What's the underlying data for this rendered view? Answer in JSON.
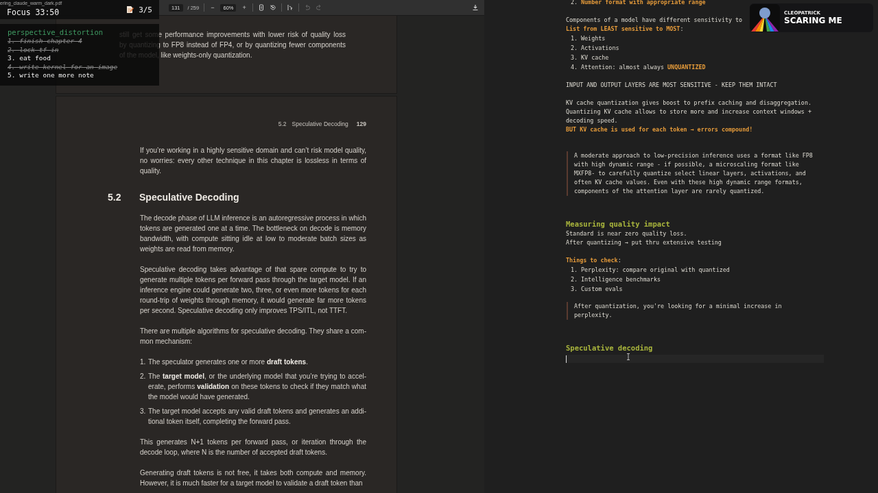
{
  "pdf_viewer": {
    "file_name": "ering_claude_warm_dark.pdf",
    "toolbar": {
      "page": "131",
      "page_total": "/ 259",
      "zoom_out": "−",
      "zoom": "60%",
      "zoom_in": "+",
      "history_disabled": true
    },
    "previous_page": {
      "lines": [
        "still get some performance improvements with lower risk of quality loss",
        "by quantizing to FP8 instead of FP4, or by quantizing fewer components",
        "of the model, like weights-only quantization."
      ]
    },
    "page": {
      "running_head": {
        "section": "5.2",
        "title": "Speculative Decoding",
        "page_number": "129"
      },
      "blocks": [
        {
          "kind": "paragraph",
          "lines": [
            "If you’re working in a highly sensitive domain and can’t risk model quality,",
            "no worries: every other technique in this chapter is lossless in terms of",
            "quality."
          ]
        },
        {
          "kind": "heading",
          "number": "5.2",
          "title": "Speculative Decoding"
        },
        {
          "kind": "paragraph",
          "lines": [
            "The decode phase of LLM inference is an autoregressive process in which",
            "tokens are generated one at a time. The bottleneck on decode is memory",
            "bandwidth, with compute sitting idle at low to moderate batch sizes as",
            "weights are read from memory."
          ]
        },
        {
          "kind": "paragraph",
          "lines": [
            "Speculative decoding takes advantage of that spare compute to try to",
            "generate multiple tokens per forward pass through the target model. If an",
            "inference engine could generate two, three, or even more tokens for each",
            "round-trip of weights through memory, it would generate far more tokens",
            "per second. Speculative decoding only improves TPS/ITL, not TTFT."
          ]
        },
        {
          "kind": "paragraph",
          "lines": [
            "There are multiple algorithms for speculative decoding. They share a com-",
            "mon mechanism:"
          ]
        },
        {
          "kind": "list",
          "items": [
            {
              "number": "1.",
              "lines": [
                "The speculator generates one or more **draft tokens**."
              ]
            },
            {
              "number": "2.",
              "lines": [
                "The **target model**, or the underlying model that you’re trying to accel-",
                "erate, performs **validation** on these tokens to check if they match what",
                "the model would have generated."
              ]
            },
            {
              "number": "3.",
              "lines": [
                "The target model accepts any valid draft tokens and generates an addi-",
                "tional token itself, completing the forward pass."
              ]
            }
          ]
        },
        {
          "kind": "paragraph",
          "lines": [
            "This generates N+1 tokens per forward pass, or iteration through the",
            "decode loop, where N is the number of accepted draft tokens."
          ]
        },
        {
          "kind": "paragraph",
          "lines": [
            "Generating draft tokens is not free, it takes both compute and memory.",
            "However, it is much faster for a target model to validate a draft token than"
          ]
        }
      ]
    }
  },
  "focus_timer": {
    "label": "Focus 33:50",
    "count": "3/5"
  },
  "todo": {
    "title": "perspective_distortion",
    "items": [
      {
        "text": "1. finish chapter 4",
        "done": true
      },
      {
        "text": "2. lock tf in",
        "done": true
      },
      {
        "text": "3. eat food",
        "done": false
      },
      {
        "text": "4. write kernel for an image",
        "done": true
      },
      {
        "text": "5. write one more note",
        "done": false
      }
    ]
  },
  "notes": {
    "blocks": [
      {
        "kind": "list",
        "items": [
          {
            "number": "2.",
            "parts": [
              {
                "text": "Number format with appropriate range",
                "kind": "accent"
              }
            ]
          }
        ]
      },
      {
        "kind": "text",
        "lines": [
          [
            {
              "text": "Components of a model have different sensitivity to",
              "kind": "plain"
            }
          ],
          [
            {
              "text": "List from LEAST sensitive to MOST",
              "kind": "accent"
            },
            {
              "text": ":",
              "kind": "plain"
            }
          ]
        ]
      },
      {
        "kind": "list",
        "items": [
          {
            "number": "1.",
            "parts": [
              {
                "text": "Weights",
                "kind": "plain"
              }
            ]
          },
          {
            "number": "2.",
            "parts": [
              {
                "text": "Activations",
                "kind": "plain"
              }
            ]
          },
          {
            "number": "3.",
            "parts": [
              {
                "text": "KV cache",
                "kind": "plain"
              }
            ]
          },
          {
            "number": "4.",
            "parts": [
              {
                "text": "Attention: almost always ",
                "kind": "plain"
              },
              {
                "text": "UNQUANTIZED",
                "kind": "accent"
              }
            ]
          }
        ]
      },
      {
        "kind": "text",
        "lines": [
          [
            {
              "text": "INPUT AND OUTPUT LAYERS ARE MOST SENSITIVE - KEEP THEM INTACT",
              "kind": "plain"
            }
          ]
        ]
      },
      {
        "kind": "text",
        "lines": [
          [
            {
              "text": "KV cache quantization gives boost to prefix caching and disaggregation.",
              "kind": "plain"
            }
          ],
          [
            {
              "text": "Quantizing KV cache allows to store more and increase context windows +",
              "kind": "plain"
            }
          ],
          [
            {
              "text": "decoding speed.",
              "kind": "plain"
            }
          ],
          [
            {
              "text": "BUT KV cache is used for each token → errors compound!",
              "kind": "accent"
            }
          ]
        ]
      },
      {
        "kind": "quote",
        "lines": [
          "A moderate approach to low-precision inference uses a format like FP8",
          "with high dynamic range - if possible, a microscaling format like",
          "MXFP8- to carefully quantize select linear layers, activations, and",
          "often KV cache values. Even with these high dynamic range formats,",
          "components of the attention layer are rarely quantized."
        ]
      },
      {
        "kind": "section",
        "lines": [
          [
            {
              "text": "Measuring quality impact",
              "kind": "heading"
            }
          ],
          [
            {
              "text": "Standard is near zero quality loss.",
              "kind": "plain"
            }
          ],
          [
            {
              "text": "After quantizing → put thru extensive testing",
              "kind": "plain"
            }
          ]
        ]
      },
      {
        "kind": "text",
        "lines": [
          [
            {
              "text": "Things to check",
              "kind": "accent"
            },
            {
              "text": ":",
              "kind": "plain"
            }
          ]
        ]
      },
      {
        "kind": "list",
        "items": [
          {
            "number": "1.",
            "parts": [
              {
                "text": "Perplexity: compare original with quantized",
                "kind": "plain"
              }
            ]
          },
          {
            "number": "2.",
            "parts": [
              {
                "text": "Intelligence benchmarks",
                "kind": "plain"
              }
            ]
          },
          {
            "number": "3.",
            "parts": [
              {
                "text": "Custom evals",
                "kind": "plain"
              }
            ]
          }
        ]
      },
      {
        "kind": "quote",
        "lines": [
          "After quantization, you're looking for a minimal increase in",
          "perplexity."
        ]
      },
      {
        "kind": "section",
        "lines": [
          [
            {
              "text": "Speculative decoding",
              "kind": "heading"
            }
          ]
        ]
      }
    ]
  },
  "stream_alert": {
    "name": "CLEOPATRICK",
    "message": "SCARING ME"
  }
}
